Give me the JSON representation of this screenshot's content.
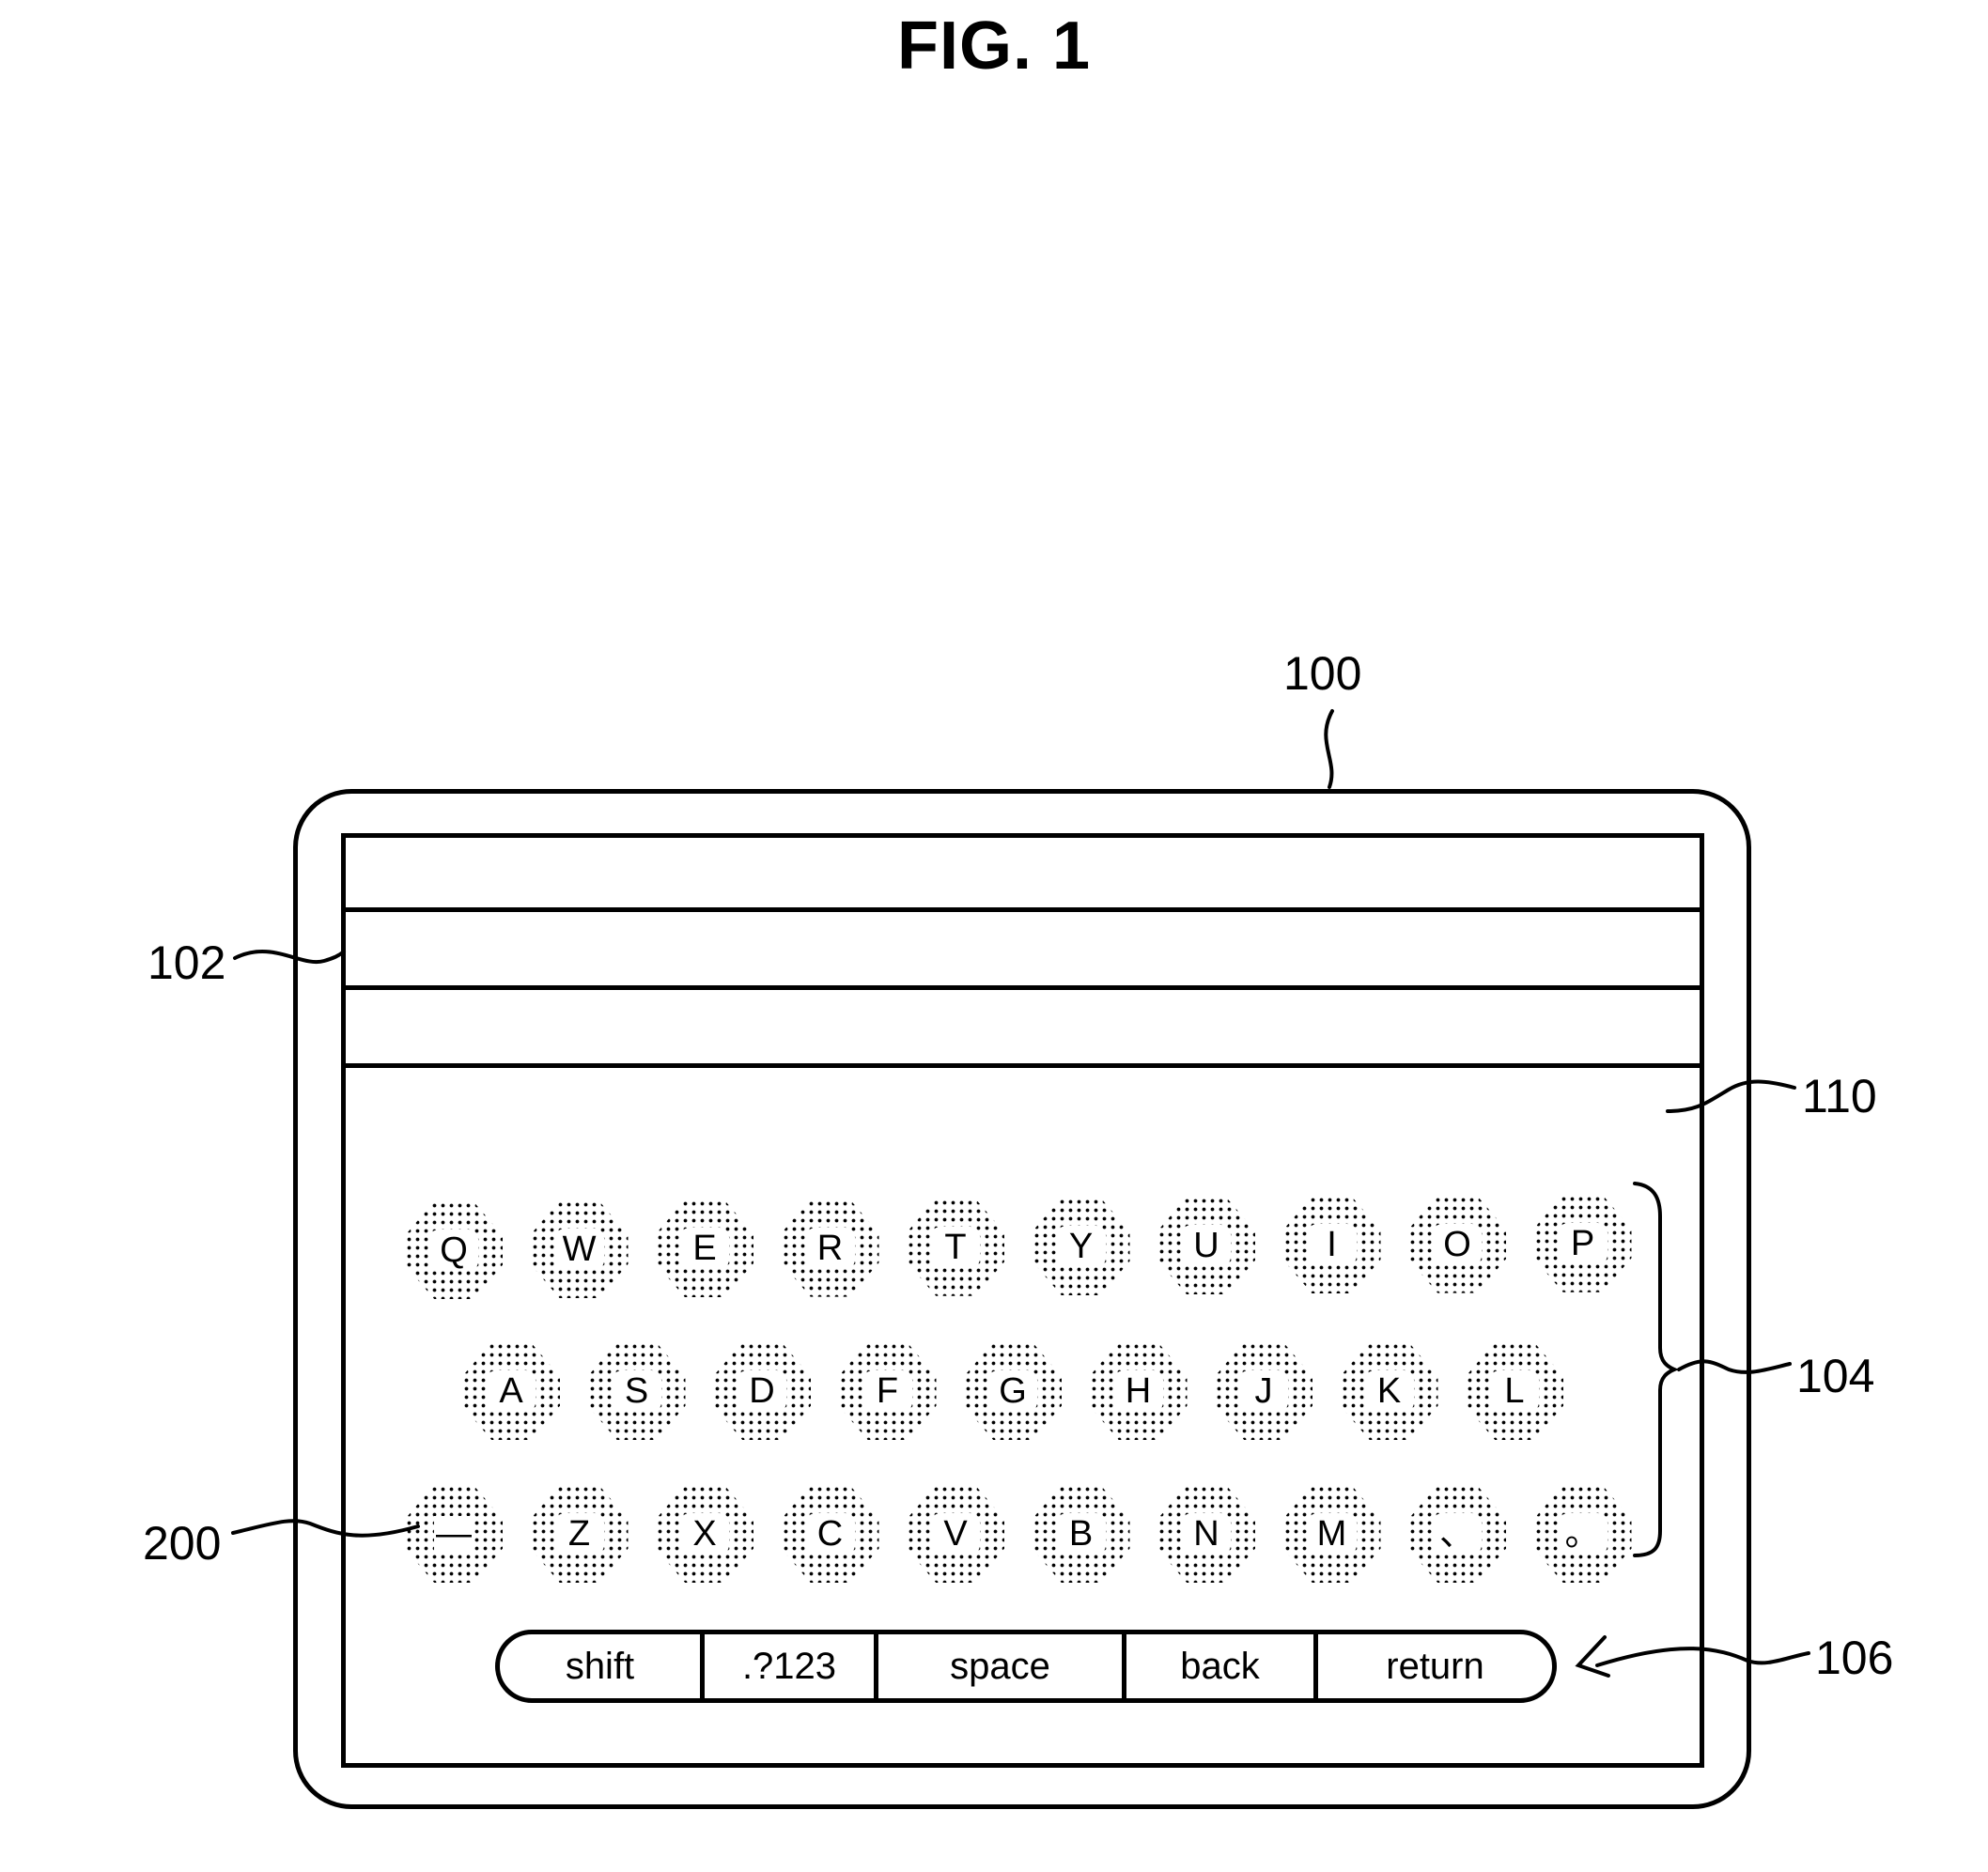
{
  "figure": {
    "title": "FIG. 1"
  },
  "reference_labels": {
    "device": "100",
    "display_area": "102",
    "keyboard": "104",
    "function_bar": "106",
    "screen": "110",
    "key": "200"
  },
  "keyboard": {
    "rows": [
      [
        "Q",
        "W",
        "E",
        "R",
        "T",
        "Y",
        "U",
        "I",
        "O",
        "P"
      ],
      [
        "A",
        "S",
        "D",
        "F",
        "G",
        "H",
        "J",
        "K",
        "L"
      ],
      [
        "—",
        "Z",
        "X",
        "C",
        "V",
        "B",
        "N",
        "M",
        "、",
        "。"
      ]
    ]
  },
  "function_bar": {
    "keys": [
      "shift",
      ".?123",
      "space",
      "back",
      "return"
    ]
  }
}
